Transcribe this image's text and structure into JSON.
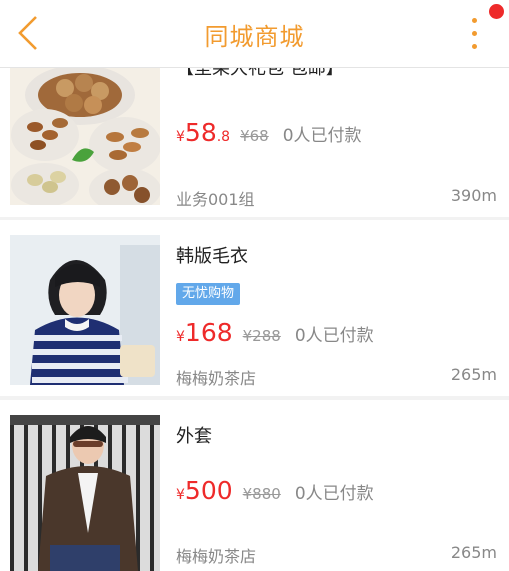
{
  "header": {
    "title": "同城商城",
    "colors": {
      "accent": "#f29b2f",
      "badge": "#ee2a2a"
    },
    "icons": {
      "back": "back-chevron-icon",
      "more": "more-vertical-icon"
    }
  },
  "products": [
    {
      "name": "【坚果大礼包 包邮】",
      "currency": "¥",
      "price": "58",
      "cents": ".8",
      "original_price": "¥68",
      "paid_text": "0人已付款",
      "shop": "业务001组",
      "distance": "390m",
      "tag": ""
    },
    {
      "name": "韩版毛衣",
      "currency": "¥",
      "price": "168",
      "cents": "",
      "original_price": "¥288",
      "paid_text": "0人已付款",
      "shop": "梅梅奶茶店",
      "distance": "265m",
      "tag": "无忧购物"
    },
    {
      "name": "外套",
      "currency": "¥",
      "price": "500",
      "cents": "",
      "original_price": "¥880",
      "paid_text": "0人已付款",
      "shop": "梅梅奶茶店",
      "distance": "265m",
      "tag": ""
    }
  ]
}
